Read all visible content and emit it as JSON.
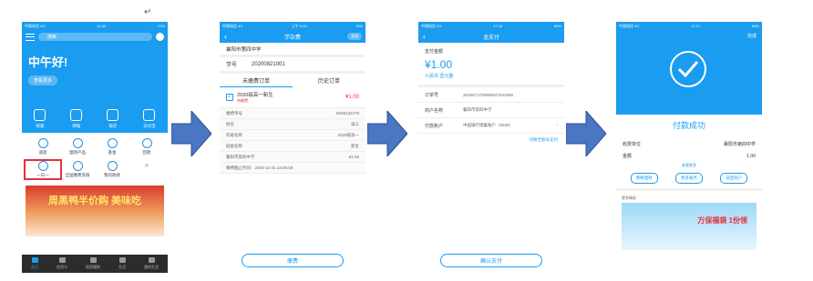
{
  "doc_mark": "↵",
  "colors": {
    "accent": "#1a9cf0",
    "price": "#e8303a",
    "tabbar": "#2c2c2c"
  },
  "screens": [
    {
      "status": {
        "left": "中国电信 4G",
        "time": "12:43",
        "right": "72%"
      },
      "search_placeholder": "搜索",
      "greeting": "中午好!",
      "greeting_pill": "查看更多",
      "quick": [
        {
          "label": "财富",
          "icon": "wealth-icon"
        },
        {
          "label": "转账",
          "icon": "transfer-icon"
        },
        {
          "label": "快贷",
          "icon": "loan-icon"
        },
        {
          "label": "支付宝",
          "icon": "pay-icon"
        }
      ],
      "grid": [
        {
          "label": "速盈",
          "icon": "speed-icon"
        },
        {
          "label": "理财产品",
          "icon": "product-icon"
        },
        {
          "label": "基金",
          "icon": "fund-icon"
        },
        {
          "label": "回款",
          "icon": "return-icon"
        },
        {
          "label": "一日一",
          "icon": "school-fee-icon",
          "selected": true
        },
        {
          "label": "全国缴费充值",
          "icon": "recharge-icon"
        },
        {
          "label": "我的收款",
          "icon": "receive-icon"
        },
        {
          "label": "+",
          "icon": "add-icon"
        }
      ],
      "banner_text": "周黑鸭半价购 美味吃",
      "tabs": [
        {
          "label": "首页",
          "icon": "home-icon",
          "active": true
        },
        {
          "label": "信用卡",
          "icon": "card-icon"
        },
        {
          "label": "投资理财",
          "icon": "invest-icon"
        },
        {
          "label": "生活",
          "icon": "life-icon"
        },
        {
          "label": "我的生活",
          "icon": "me-icon"
        }
      ]
    },
    {
      "status": {
        "left": "中国电信 4G",
        "time": "上午 9:43",
        "right": "75%"
      },
      "title": "学杂费",
      "close_label": "关闭",
      "school": "襄阳市第四中学",
      "student_label": "学号",
      "student_id": "20200821001",
      "tab_unpaid": "未缴费订单",
      "tab_history": "历史订单",
      "order_title": "2020级高一新生",
      "order_sub": "待缴费",
      "order_amount": "¥1.00",
      "details": [
        {
          "k": "缴费单号",
          "v": "6046132279"
        },
        {
          "k": "姓名",
          "v": "张三"
        },
        {
          "k": "年级名称",
          "v": "2020级高一"
        },
        {
          "k": "班级名称",
          "v": "新生"
        },
        {
          "k": "襄阳市第四中学",
          "v": "¥1.00"
        }
      ],
      "deadline": "缴费截止时间：2020-12-31 23:59:59",
      "button": "缴费"
    },
    {
      "status": {
        "left": "中国电信 4G",
        "time": "17:16",
        "right": "69%"
      },
      "title": "龙支付",
      "pay_label": "支付金额",
      "amount": "¥1.00",
      "currency": "人民币 壹元整",
      "rows": [
        {
          "k": "订单号",
          "v": "2018071700000047941066"
        },
        {
          "k": "商户名称",
          "v": "襄阳市第四中学"
        },
        {
          "k": "付款账户",
          "v": "中国银行储蓄账户（6329）"
        }
      ],
      "switch_link": "切换至账号支付",
      "button": "确认支付"
    },
    {
      "status": {
        "left": "中国电信 4G",
        "time": "17:17",
        "right": "68%"
      },
      "done": "完成",
      "success": "付款成功",
      "rows": [
        {
          "k": "收费单位",
          "v": "襄阳市第四中学"
        },
        {
          "k": "金额",
          "v": "1.00"
        }
      ],
      "more": "查看更多",
      "actions": [
        "我要理财",
        "更多服务",
        "返回商户"
      ],
      "more_title": "更多精彩",
      "ad_text": "万保福袋 1份领"
    }
  ]
}
